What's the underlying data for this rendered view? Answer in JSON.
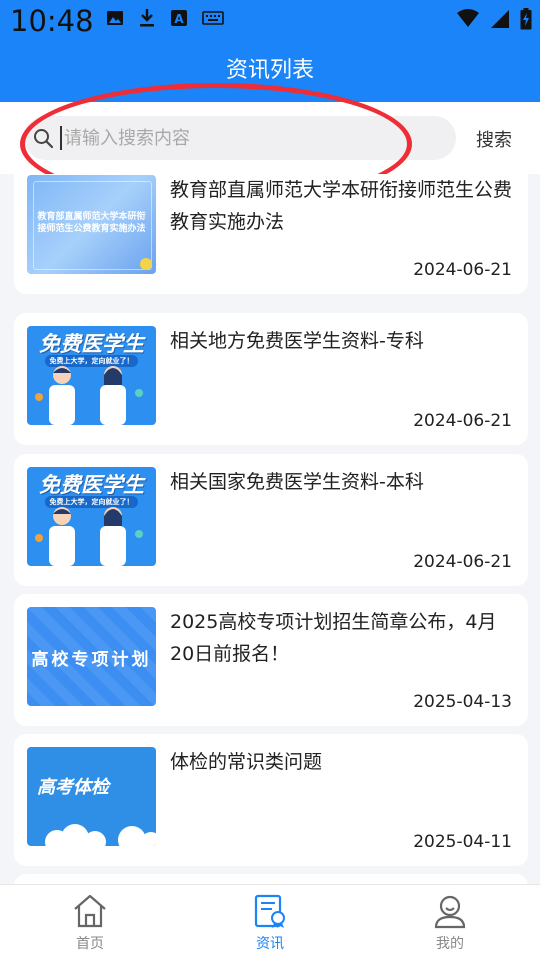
{
  "status_bar": {
    "time": "10:48",
    "icons_left": [
      "image-icon",
      "download-icon",
      "app-a-icon",
      "keyboard-icon"
    ],
    "icons_right": [
      "wifi-icon",
      "signal-icon",
      "battery-charging-icon"
    ]
  },
  "header": {
    "title": "资讯列表",
    "background": "#1a84f8"
  },
  "search": {
    "placeholder": "请输入搜索内容",
    "value": "",
    "button_label": "搜索"
  },
  "annotation": {
    "color": "#ee2d36"
  },
  "news": [
    {
      "title": "教育部直属师范大学本研衔接师范生公费教育实施办法",
      "date": "2024-06-21",
      "thumb_text": "教育部直属师范大学本研衔接师范生公费教育实施办法"
    },
    {
      "title": "相关地方免费医学生资料-专科",
      "date": "2024-06-21",
      "thumb_text": "免费医学生",
      "thumb_subtext": "免费上大学，定向就业了！"
    },
    {
      "title": "相关国家免费医学生资料-本科",
      "date": "2024-06-21",
      "thumb_text": "免费医学生",
      "thumb_subtext": "免费上大学，定向就业了！"
    },
    {
      "title": "2025高校专项计划招生简章公布，4月20日前报名！",
      "date": "2025-04-13",
      "thumb_text": "高校专项计划"
    },
    {
      "title": "体检的常识类问题",
      "date": "2025-04-11",
      "thumb_text": "高考体检"
    }
  ],
  "bottom_nav": {
    "items": [
      {
        "label": "首页",
        "icon": "home-icon",
        "active": false
      },
      {
        "label": "资讯",
        "icon": "news-document-icon",
        "active": true
      },
      {
        "label": "我的",
        "icon": "profile-icon",
        "active": false
      }
    ],
    "active_color": "#1a84f8",
    "inactive_color": "#888888"
  }
}
